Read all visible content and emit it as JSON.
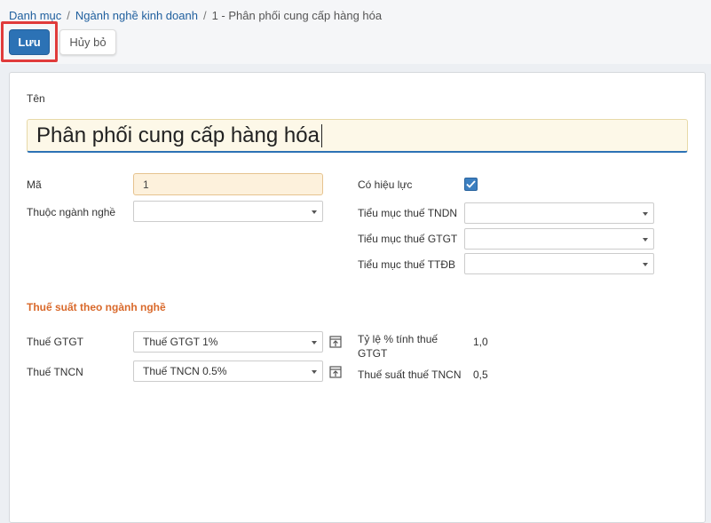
{
  "breadcrumb": {
    "items": [
      "Danh mục",
      "Ngành nghề kinh doanh",
      "1 - Phân phối cung cấp hàng hóa"
    ],
    "separator": "/"
  },
  "toolbar": {
    "save_label": "Lưu",
    "cancel_label": "Hủy bỏ"
  },
  "form": {
    "name_label": "Tên",
    "name_value": "Phân phối cung cấp hàng hóa",
    "code_label": "Mã",
    "code_value": "1",
    "parent_label": "Thuộc ngành nghề",
    "parent_value": "",
    "active_label": "Có hiệu lực",
    "active_checked": true,
    "tndn_label": "Tiểu mục thuế TNDN",
    "tndn_value": "",
    "gtgt_sub_label": "Tiểu mục thuế GTGT",
    "gtgt_sub_value": "",
    "ttdb_label": "Tiểu mục thuế TTĐB",
    "ttdb_value": ""
  },
  "tax_section": {
    "title": "Thuế suất theo ngành nghề",
    "vat_label": "Thuế GTGT",
    "vat_value": "Thuế GTGT 1%",
    "pit_label": "Thuế TNCN",
    "pit_value": "Thuế TNCN 0.5%",
    "vat_rate_label": "Tỷ lệ % tính thuế GTGT",
    "vat_rate_value": "1,0",
    "pit_rate_label": "Thuế suất thuế TNCN",
    "pit_rate_value": "0,5"
  },
  "colors": {
    "primary": "#2c72b5",
    "section_title": "#d9692b",
    "highlight": "#e03b3b"
  }
}
